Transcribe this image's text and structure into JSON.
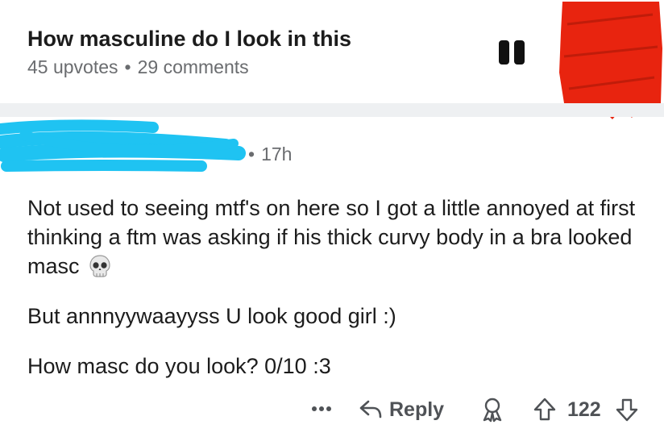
{
  "post": {
    "title": "How masculine do I look in this",
    "upvotes": "45 upvotes",
    "separator": "•",
    "comments": "29 comments"
  },
  "comment": {
    "separator": "•",
    "timestamp": "17h",
    "paragraph_1": "Not used to seeing mtf's on here so I got a little annoyed at first thinking a ftm was asking if his thick curvy body in a bra looked masc",
    "emoji": "skull",
    "paragraph_2": "But annnyywaayyss U look good girl :)",
    "paragraph_3": "How masc do you look? 0/10 :3"
  },
  "actions": {
    "reply_label": "Reply",
    "score": "122"
  },
  "colors": {
    "scribble_blue": "#1fc3f2",
    "scribble_red": "#e8240f",
    "meta_gray": "#6a6c6f",
    "action_gray": "#4f5256"
  },
  "icons": [
    "pause-icon",
    "more-icon",
    "reply-icon",
    "award-icon",
    "upvote-icon",
    "downvote-icon",
    "skull-emoji"
  ]
}
